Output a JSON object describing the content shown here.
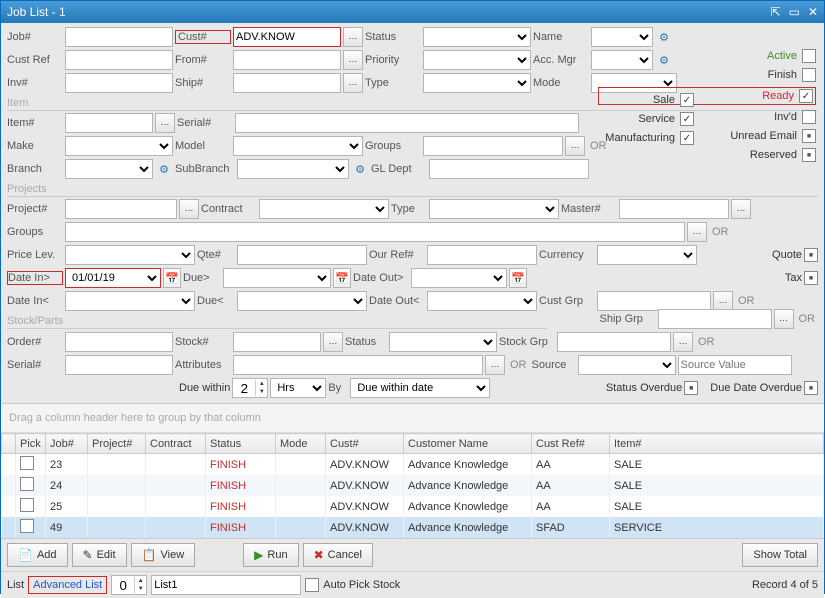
{
  "window": {
    "title": "Job List - 1"
  },
  "filters": {
    "job_no_label": "Job#",
    "cust_no_label": "Cust#",
    "cust_no_value": "ADV.KNOW",
    "status_label": "Status",
    "name_label": "Name",
    "custref_label": "Cust Ref",
    "from_no_label": "From#",
    "priority_label": "Priority",
    "accmgr_label": "Acc. Mgr",
    "inv_no_label": "Inv#",
    "ship_no_label": "Ship#",
    "type_label": "Type",
    "mode_label": "Mode"
  },
  "status_checks": {
    "active": "Active",
    "finish": "Finish",
    "ready": "Ready",
    "invd": "Inv'd",
    "unread": "Unread Email",
    "reserved": "Reserved",
    "sale": "Sale",
    "service": "Service",
    "manufacturing": "Manufacturing",
    "quote": "Quote",
    "tax": "Tax"
  },
  "item_section": {
    "header": "Item",
    "item_no": "Item#",
    "serial_no": "Serial#",
    "make": "Make",
    "model": "Model",
    "groups": "Groups",
    "branch": "Branch",
    "subbranch": "SubBranch",
    "gldept": "GL Dept"
  },
  "projects_section": {
    "header": "Projects",
    "project_no": "Project#",
    "contract": "Contract",
    "type": "Type",
    "master_no": "Master#",
    "groups": "Groups",
    "price_lev": "Price Lev.",
    "qte_no": "Qte#",
    "ourref": "Our Ref#",
    "currency": "Currency",
    "date_in_gt": "Date In>",
    "date_in_gt_val": "01/01/19",
    "due_gt": "Due>",
    "date_out_gt": "Date Out>",
    "date_in_lt": "Date In<",
    "due_lt": "Due<",
    "date_out_lt": "Date Out<",
    "custgrp": "Cust Grp",
    "shipgrp": "Ship Grp"
  },
  "stock_section": {
    "header": "Stock/Parts",
    "order_no": "Order#",
    "stock_no": "Stock#",
    "status": "Status",
    "stockgrp": "Stock Grp",
    "serial_no": "Serial#",
    "attributes": "Attributes",
    "source": "Source",
    "source_value_ph": "Source Value",
    "due_within": "Due within",
    "due_within_val": "2",
    "hrs": "Hrs",
    "by": "By",
    "by_val": "Due within date",
    "status_overdue": "Status Overdue",
    "due_date_overdue": "Due Date Overdue"
  },
  "grid": {
    "group_hint": "Drag a column header here to group by that column",
    "columns": [
      "",
      "Pick",
      "Job#",
      "Project#",
      "Contract",
      "Status",
      "Mode",
      "Cust#",
      "Customer Name",
      "Cust Ref#",
      "Item#"
    ],
    "rows": [
      {
        "job": "23",
        "status": "FINISH",
        "cust": "ADV.KNOW",
        "cname": "Advance Knowledge",
        "cref": "AA",
        "item": "SALE"
      },
      {
        "job": "24",
        "status": "FINISH",
        "cust": "ADV.KNOW",
        "cname": "Advance Knowledge",
        "cref": "AA",
        "item": "SALE"
      },
      {
        "job": "25",
        "status": "FINISH",
        "cust": "ADV.KNOW",
        "cname": "Advance Knowledge",
        "cref": "AA",
        "item": "SALE"
      },
      {
        "job": "49",
        "status": "FINISH",
        "cust": "ADV.KNOW",
        "cname": "Advance Knowledge",
        "cref": "SFAD",
        "item": "SERVICE"
      }
    ]
  },
  "footer": {
    "add": "Add",
    "edit": "Edit",
    "view": "View",
    "run": "Run",
    "cancel": "Cancel",
    "show_total": "Show Total",
    "list": "List",
    "adv_list": "Advanced List",
    "list_count": "0",
    "list_name": "List1",
    "auto_pick": "Auto Pick Stock",
    "record": "Record 4 of 5"
  },
  "or": "OR"
}
